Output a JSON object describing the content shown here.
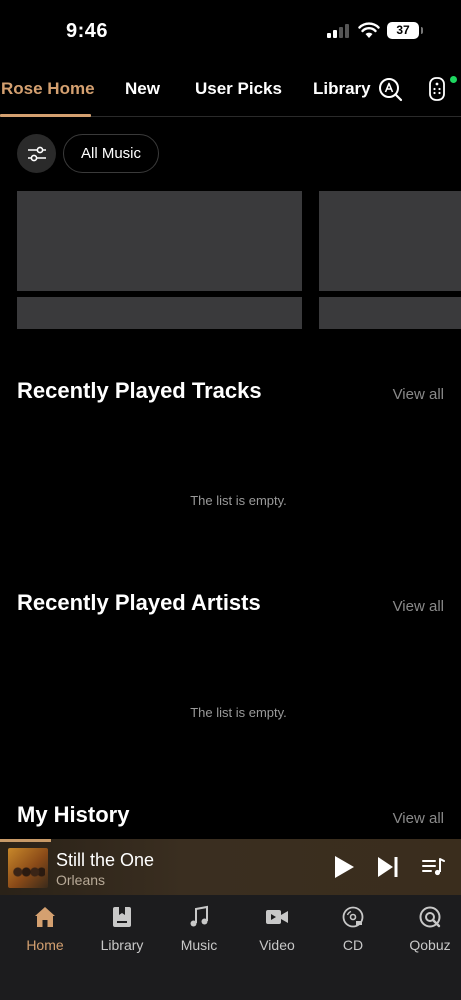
{
  "status_bar": {
    "time": "9:46",
    "battery": "37"
  },
  "top_nav": {
    "tabs": [
      {
        "label": "Rose Home",
        "active": true
      },
      {
        "label": "New",
        "active": false
      },
      {
        "label": "User Picks",
        "active": false
      },
      {
        "label": "Library",
        "active": false
      }
    ],
    "icons": [
      "search-text-icon",
      "remote-control-icon"
    ]
  },
  "filter": {
    "chip_label": "All Music",
    "icon": "sliders-icon"
  },
  "sections": [
    {
      "title": "Recently Played Tracks",
      "view_all": "View all",
      "empty_text": "The list is empty."
    },
    {
      "title": "Recently Played Artists",
      "view_all": "View all",
      "empty_text": "The list is empty."
    },
    {
      "title": "My History",
      "view_all": "View all"
    }
  ],
  "player": {
    "song": "Still the One",
    "artist": "Orleans",
    "progress": 0.11
  },
  "bottom_nav": {
    "items": [
      {
        "label": "Home",
        "icon": "home-icon",
        "active": true
      },
      {
        "label": "Library",
        "icon": "library-icon",
        "active": false
      },
      {
        "label": "Music",
        "icon": "music-note-icon",
        "active": false
      },
      {
        "label": "Video",
        "icon": "video-icon",
        "active": false
      },
      {
        "label": "CD",
        "icon": "cd-icon",
        "active": false
      },
      {
        "label": "Qobuz",
        "icon": "qobuz-icon",
        "active": false
      }
    ]
  },
  "colors": {
    "accent": "#d4a070",
    "background": "#000000",
    "skeleton": "#3a3a3c",
    "muted": "#8a8a8a"
  }
}
